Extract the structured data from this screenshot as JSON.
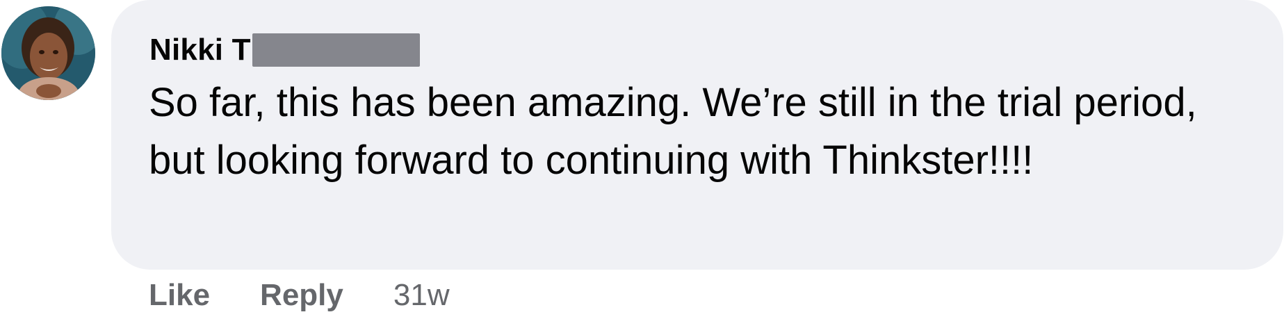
{
  "comment": {
    "author": "Nikki T",
    "author_redacted": true,
    "text": "So far, this has been amazing. We’re still in the trial period, but looking forward to continuing with Thinkster!!!!",
    "bubble_color": "#f0f1f5",
    "text_color": "#050505"
  },
  "actions": {
    "like_label": "Like",
    "reply_label": "Reply",
    "timestamp": "31w",
    "secondary_color": "#65676b"
  },
  "icons": {
    "avatar": "profile-photo"
  }
}
